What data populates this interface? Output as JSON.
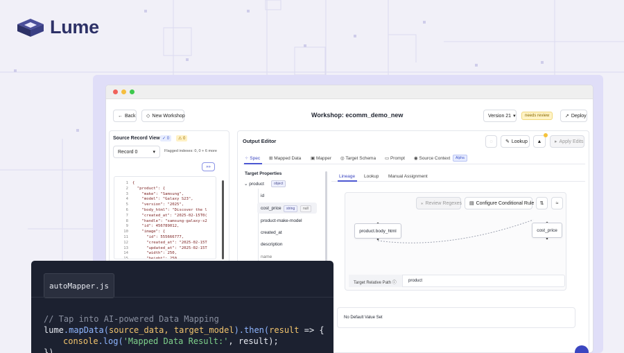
{
  "brand": {
    "name": "Lume"
  },
  "toolbar": {
    "back": "Back",
    "new_workshop": "New Workshop",
    "workshop_title": "Workshop: ecomm_demo_new",
    "version": "Version 21",
    "status": "needs review",
    "deploy": "Deploy"
  },
  "viewer": {
    "title": "Source Record Viewer",
    "check_count": "0",
    "warn_count": "0",
    "record_select": "Record 0",
    "flagged": "Flagged indexes: 0, 0 + 6 more",
    "expand": "»»"
  },
  "code_lines": [
    {
      "n": "1",
      "t": "{"
    },
    {
      "n": "2",
      "t": "  \"product\": {"
    },
    {
      "n": "3",
      "t": "    \"make\": \"Samsung\","
    },
    {
      "n": "4",
      "t": "    \"model\": \"Galaxy S23\","
    },
    {
      "n": "5",
      "t": "    \"version\": \"2025\","
    },
    {
      "n": "6",
      "t": "    \"body_html\": \"Discover the l"
    },
    {
      "n": "7",
      "t": "    \"created_at\": \"2025-02-15T0("
    },
    {
      "n": "8",
      "t": "    \"handle\": \"samsung-galaxy-s2"
    },
    {
      "n": "9",
      "t": "    \"id\": 456789012,"
    },
    {
      "n": "10",
      "t": "    \"image\": {"
    },
    {
      "n": "11",
      "t": "      \"id\": 555666777,"
    },
    {
      "n": "12",
      "t": "      \"created_at\": \"2025-02-15T"
    },
    {
      "n": "13",
      "t": "      \"updated_at\": \"2025-02-15T"
    },
    {
      "n": "14",
      "t": "      \"width\": 250,"
    },
    {
      "n": "15",
      "t": "      \"height\": 250,"
    }
  ],
  "output": {
    "title": "Output Editor",
    "lookup": "Lookup",
    "apply_edits": "Apply Edits"
  },
  "tabs": [
    "Spec",
    "Mapped Data",
    "Mapper",
    "Target Schema",
    "Prompt",
    "Source Context"
  ],
  "alpha": "Alpha",
  "target_properties": {
    "title": "Target Properties",
    "root": "product",
    "root_type": "object",
    "items": [
      "id",
      "cost_price",
      "product-make-model",
      "created_at",
      "description",
      "name"
    ],
    "type_string": "string",
    "type_null": "null"
  },
  "sub_tabs": [
    "Lineage",
    "Lookup",
    "Manual Assignment"
  ],
  "lineage": {
    "review_regexes": "Review Regexes",
    "conditional_rule": "Configure Conditional Rule",
    "source_node": "product.body_html",
    "target_node": "cost_price",
    "relative_path_label": "Target Relative Path",
    "relative_path_value": "product",
    "default_value": "No Default Value Set"
  },
  "codecard": {
    "tab": "autoMapper.js",
    "comment": "// Tap into AI-powered Data Mapping",
    "line2": {
      "obj": "lume",
      "method": ".mapData(",
      "args": "source_data, target_model",
      "close": ").then(",
      "param": "result",
      "arrow": " => {"
    },
    "line3": {
      "obj": "console",
      "method": ".log(",
      "str": "'Mapped Data Result:'",
      "rest": ", result);"
    },
    "line4": "})"
  },
  "colors": {
    "brand": "#2d3167",
    "accent": "#4b56d2",
    "warn": "#f5c33b",
    "codebg": "#1c2130"
  }
}
